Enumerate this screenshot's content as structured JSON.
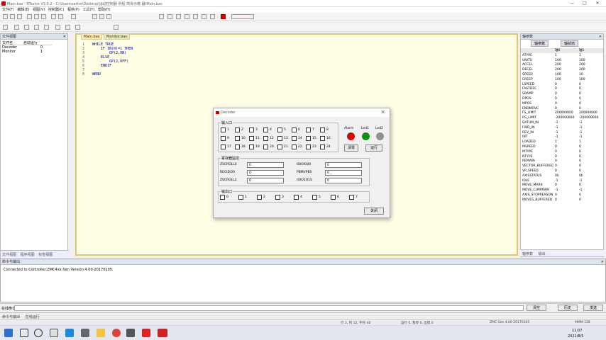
{
  "window": {
    "title": "Main.bas - RTsolve V3.0.2 - C:\\Users\\sethw\\Desktop\\运动控制器 例程 简易示教 器\\Main.bas",
    "minimize": "—",
    "maximize": "□",
    "close": "✕"
  },
  "menubar": [
    "文件(F)",
    "编辑(E)",
    "视图(V)",
    "控制器(C)",
    "程序(P)",
    "工具(T)",
    "帮助(H)"
  ],
  "left_panel": {
    "title": "文件视图",
    "close": "✕",
    "headers": [
      "文件名",
      "自动运行"
    ],
    "rows": [
      [
        "Decoder",
        "0"
      ],
      [
        "Monitor",
        "1"
      ]
    ],
    "tabs": [
      "文件视图",
      "程序视图",
      "标签视图"
    ]
  },
  "editor": {
    "tabs": [
      "Main.bas",
      "Monitor.bas"
    ],
    "lines": [
      "1",
      "2",
      "3",
      "4",
      "5",
      "6",
      "7",
      "8"
    ],
    "code": [
      "WHILE TRUE",
      "    IF IN(0)=1 THEN",
      "        OP(2,ON)",
      "    ELSE",
      "        OP(2,OFF)",
      "    ENDIF",
      "",
      "WEND"
    ]
  },
  "right_panel": {
    "title": "轴参数",
    "tabs": [
      "轴参数",
      "轴状态"
    ],
    "headers": [
      "",
      "轴0",
      "轴1"
    ],
    "rows": [
      [
        "ATYPE",
        "1",
        "1"
      ],
      [
        "UNITS",
        "100",
        "100"
      ],
      [
        "ACCEL",
        "200",
        "200"
      ],
      [
        "DECEL",
        "200",
        "200"
      ],
      [
        "SPEED",
        "100",
        "10"
      ],
      [
        "CREEP",
        "100",
        "100"
      ],
      [
        "LSPEED",
        "0",
        "0"
      ],
      [
        "FASTDEC",
        "0",
        "0"
      ],
      [
        "SRAMP",
        "0",
        "0"
      ],
      [
        "DPOS",
        "0",
        "0"
      ],
      [
        "MPOS",
        "0",
        "0"
      ],
      [
        "ENDMOVE",
        "0",
        "0"
      ],
      [
        "FS_LIMIT",
        "200000000",
        "200000000"
      ],
      [
        "RS_LIMIT",
        "-200000000",
        "-200000000"
      ],
      [
        "DATUM_IN",
        "-1",
        "-1"
      ],
      [
        "FWD_IN",
        "-1",
        "-1"
      ],
      [
        "REV_IN",
        "-1",
        "-1"
      ],
      [
        "INT",
        "-1",
        "-1"
      ],
      [
        "LOADED",
        "1",
        "1"
      ],
      [
        "MSPEED",
        "0",
        "0"
      ],
      [
        "MTYPE",
        "0",
        "0"
      ],
      [
        "NTYPE",
        "0",
        "0"
      ],
      [
        "REMAIN",
        "0",
        "0"
      ],
      [
        "VECTOR_BUFFERED",
        "0",
        "0"
      ],
      [
        "VP_SPEED",
        "0",
        "0"
      ],
      [
        "AXISSTATUS",
        "0h",
        "0h"
      ],
      [
        "IDLE",
        "-1",
        "-1"
      ],
      [
        "MOVE_MARK",
        "0",
        "0"
      ],
      [
        "MOVE_CURMARK",
        "-1",
        "-1"
      ],
      [
        "AXIS_STOPREASON",
        "0",
        "0"
      ],
      [
        "MOVES_BUFFERED",
        "0",
        "0"
      ]
    ],
    "bottom_tabs": [
      "轴参数",
      "输出"
    ]
  },
  "output": {
    "title": "命令与输出",
    "text": "Connected to Controller:ZMC4xx-Sim Version:4.00-20170105."
  },
  "cmdbar": {
    "label": "在线命令:",
    "clear": "清空",
    "hist": "历史",
    "send": "发送"
  },
  "output_tabs": [
    "命令与输出",
    "在线运行"
  ],
  "statusbar": {
    "pos": "行 3, 列 12, 字符 40",
    "mode": "运行 0, 暂停 0, 出错 0",
    "ver": "ZMC-Sim 4.00-20170105",
    "right": "MMM 128"
  },
  "clock": {
    "time": "11:07",
    "date": "2021/8/5"
  },
  "dialog": {
    "title": "Decoder",
    "close": "✕",
    "input_group": "输入口",
    "inputs": [
      "1",
      "2",
      "3",
      "4",
      "5",
      "6",
      "7",
      "8",
      "9",
      "10",
      "11",
      "12",
      "13",
      "14",
      "15",
      "16",
      "17",
      "18",
      "19",
      "20",
      "21",
      "22",
      "23",
      "24"
    ],
    "leds": [
      {
        "label": "Alarm",
        "color": "#e00000"
      },
      {
        "label": "Led1",
        "color": "#109010"
      },
      {
        "label": "Led2",
        "color": "#909090"
      }
    ],
    "btn_reset": "清零",
    "btn_run": "运行",
    "monitor_group": "寄存器监控",
    "fields": [
      {
        "label": "ZSCROLL0",
        "value": "0"
      },
      {
        "label": "IDIOIO00",
        "value": "0"
      },
      {
        "label": "RECIEIO0",
        "value": "0"
      },
      {
        "label": "PBMVPBS",
        "value": "0 _"
      },
      {
        "label": "ZSCROLL2",
        "value": "0"
      },
      {
        "label": "IOIO1O1S",
        "value": "0"
      }
    ],
    "output_group": "输出口",
    "outputs": [
      "0",
      "1",
      "2",
      "3",
      "4",
      "5",
      "6",
      "7"
    ],
    "btn_close": "关闭"
  }
}
